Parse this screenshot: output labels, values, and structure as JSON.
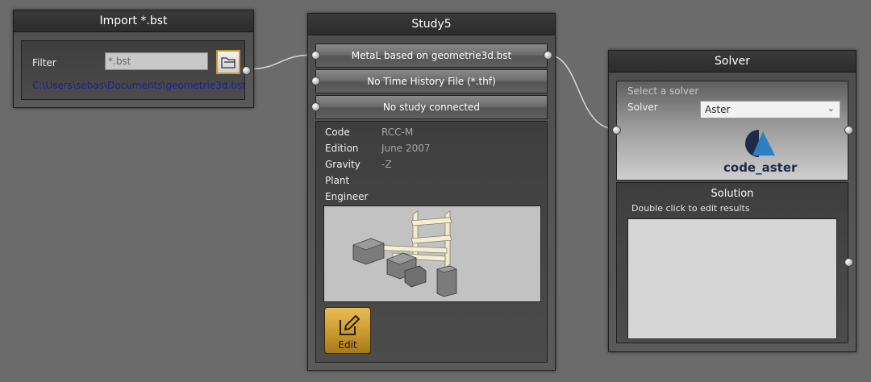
{
  "import_node": {
    "title": "Import *.bst",
    "filter_label": "Filter",
    "filter_value": "*.bst",
    "path": "C:\\Users\\sebas\\Documents\\geometrie3d.bst",
    "folder_icon": "folder-open-icon"
  },
  "study_node": {
    "title": "Study5",
    "connections": [
      "MetaL based on geometrie3d.bst",
      "No Time History File (*.thf)",
      "No study connected"
    ],
    "properties": [
      {
        "label": "Code",
        "value": "RCC-M"
      },
      {
        "label": "Edition",
        "value": "June 2007"
      },
      {
        "label": "Gravity",
        "value": "-Z"
      },
      {
        "label": "Plant",
        "value": ""
      },
      {
        "label": "Engineer",
        "value": ""
      }
    ],
    "edit_label": "Edit",
    "edit_icon": "pencil-icon"
  },
  "solver_node": {
    "title": "Solver",
    "hint": "Select a solver",
    "solver_label": "Solver",
    "solver_value": "Aster",
    "logo_text": "code_aster",
    "solution_title": "Solution",
    "solution_hint": "Double click to edit results"
  },
  "colors": {
    "background": "#6b6b6b",
    "accent_gold": "#c99a2e",
    "path_text": "#1a1f9e",
    "logo_dark": "#1e2a4a",
    "logo_blue": "#2f7ec2"
  }
}
